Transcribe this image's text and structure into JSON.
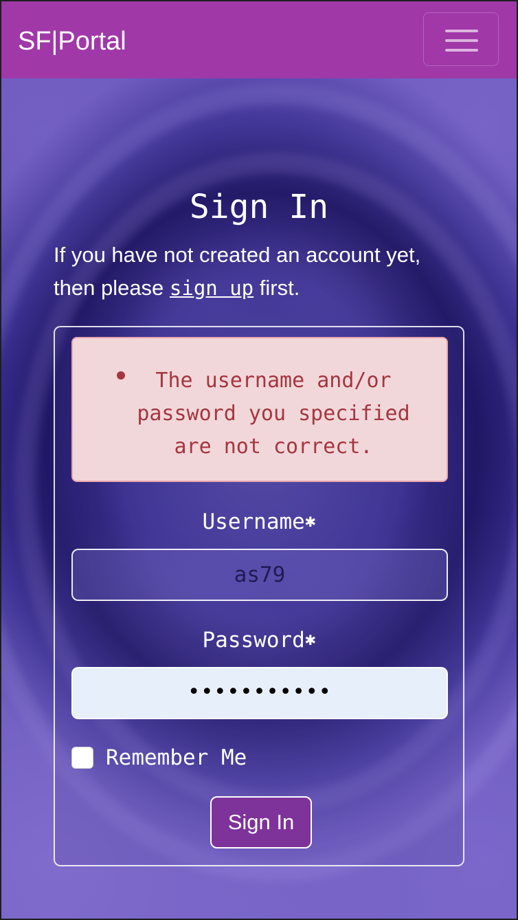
{
  "navbar": {
    "brand": "SF|Portal",
    "toggler_icon": "hamburger-menu-icon",
    "color": "#a038a8"
  },
  "page": {
    "title": "Sign In",
    "intro_before": "If you have not created an account yet, then please ",
    "intro_link": "sign up",
    "intro_after": " first."
  },
  "alert": {
    "message": "The username and/or password you specified are not correct.",
    "text_color": "#a33640",
    "background": "#f2d7da"
  },
  "form": {
    "username_label": "Username",
    "username_required": "✱",
    "username_value": "as79",
    "password_label": "Password",
    "password_required": "✱",
    "password_value": "•••••••••••",
    "remember_label": "Remember Me",
    "remember_checked": false,
    "submit_label": "Sign In",
    "submit_color": "#7d3399"
  }
}
